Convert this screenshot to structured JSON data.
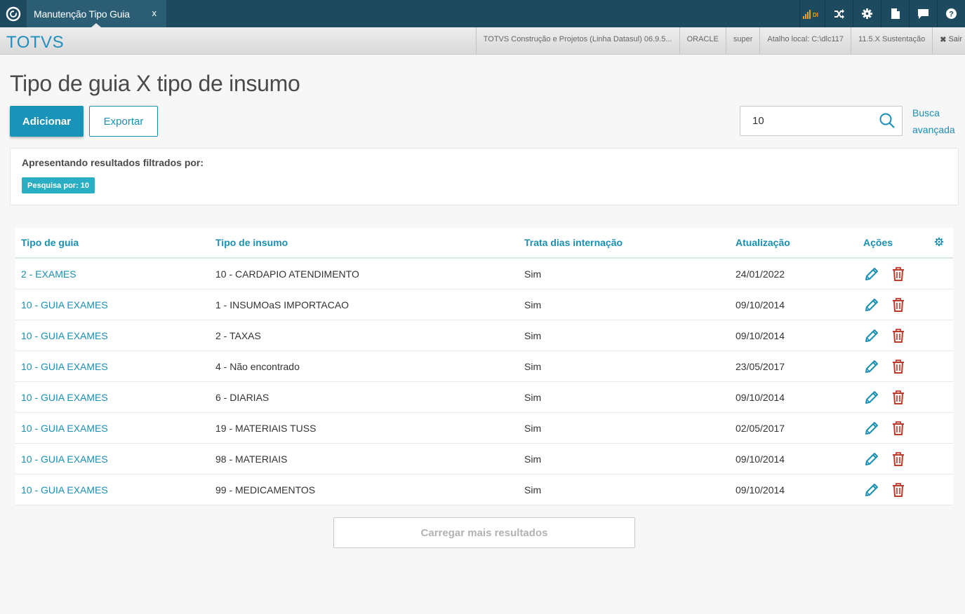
{
  "topbar": {
    "tab_label": "Manutenção Tipo Guia",
    "tab_close": "x",
    "signal_label": "DI",
    "icons": [
      "shuffle-icon",
      "gear-icon",
      "document-icon",
      "chat-icon",
      "help-icon"
    ]
  },
  "subbar": {
    "brand": "TOTVS",
    "info": [
      "TOTVS Construção e Projetos (Linha Datasul) 06.9.5...",
      "ORACLE",
      "super",
      "Atalho local: C:\\dlc117",
      "11.5.X Sustentação"
    ],
    "exit_label": "Sair"
  },
  "page": {
    "title": "Tipo de guia X tipo de insumo",
    "add_label": "Adicionar",
    "export_label": "Exportar",
    "search_value": "10",
    "advanced_search_line1": "Busca",
    "advanced_search_line2": "avançada"
  },
  "filter": {
    "text": "Apresentando resultados filtrados por:",
    "tag": "Pesquisa por: 10"
  },
  "table": {
    "headers": [
      "Tipo de guia",
      "Tipo de insumo",
      "Trata dias internação",
      "Atualização",
      "Ações"
    ],
    "rows": [
      [
        "2 - EXAMES",
        "10 - CARDAPIO ATENDIMENTO",
        "Sim",
        "24/01/2022"
      ],
      [
        "10 - GUIA EXAMES",
        "1 - INSUMOaS IMPORTACAO",
        "Sim",
        "09/10/2014"
      ],
      [
        "10 - GUIA EXAMES",
        "2 - TAXAS",
        "Sim",
        "09/10/2014"
      ],
      [
        "10 - GUIA EXAMES",
        "4 - Não encontrado",
        "Sim",
        "23/05/2017"
      ],
      [
        "10 - GUIA EXAMES",
        "6 - DIARIAS",
        "Sim",
        "09/10/2014"
      ],
      [
        "10 - GUIA EXAMES",
        "19 - MATERIAIS TUSS",
        "Sim",
        "02/05/2017"
      ],
      [
        "10 - GUIA EXAMES",
        "98 - MATERIAIS",
        "Sim",
        "09/10/2014"
      ],
      [
        "10 - GUIA EXAMES",
        "99 - MEDICAMENTOS",
        "Sim",
        "09/10/2014"
      ]
    ],
    "load_more_label": "Carregar mais resultados"
  },
  "colors": {
    "topbar": "#1e4a5f",
    "accent": "#1a93b8",
    "tag": "#2aaec4",
    "delete": "#c0392b"
  }
}
